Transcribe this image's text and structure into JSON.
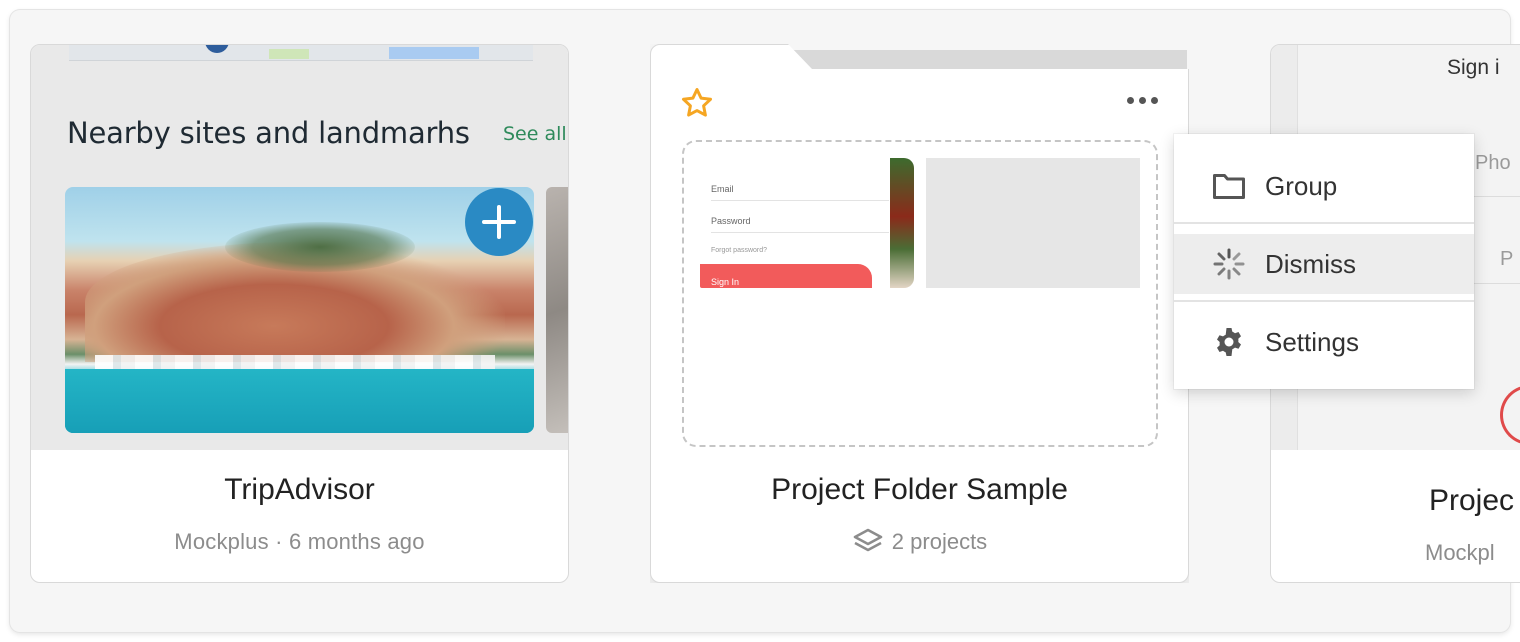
{
  "cards": [
    {
      "title": "TripAdvisor",
      "subtitle": "Mockplus · 6 months ago",
      "preview": {
        "heading": "Nearby sites and landmarhs",
        "see_all": "See all",
        "add_icon": "plus-icon"
      }
    },
    {
      "title": "Project Folder Sample",
      "project_count_label": "2 projects",
      "favorite_icon": "star-icon",
      "count_icon": "layers-icon",
      "preview": {
        "email_label": "Email",
        "password_label": "Password",
        "forgot_label": "Forgot password?",
        "signin_label": "Sign In"
      }
    },
    {
      "title": "Projec",
      "subtitle": "Mockpl",
      "preview": {
        "sign_in": "Sign i",
        "pho": "Pho",
        "p": "P"
      }
    }
  ],
  "context_menu": {
    "items": [
      {
        "label": "Group",
        "icon": "folder-icon"
      },
      {
        "label": "Dismiss",
        "icon": "spinner-icon",
        "highlighted": true
      },
      {
        "label": "Settings",
        "icon": "gear-icon"
      }
    ]
  },
  "colors": {
    "accent_star": "#f5a623",
    "add_button": "#2a8ac4",
    "see_all": "#2e8a5b",
    "signin_button": "#f25b5b"
  }
}
